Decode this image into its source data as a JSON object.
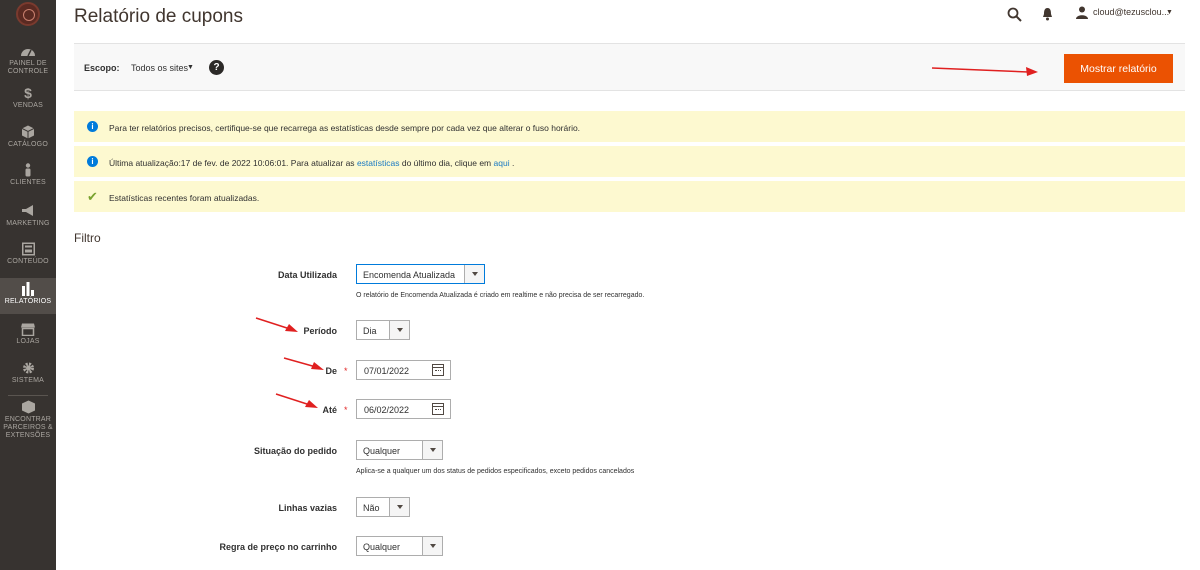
{
  "sidebar": {
    "items": [
      {
        "label": "PAINEL DE CONTROLE",
        "icon": "dashboard-icon"
      },
      {
        "label": "VENDAS",
        "icon": "dollar-icon"
      },
      {
        "label": "CATÁLOGO",
        "icon": "cube-icon"
      },
      {
        "label": "CLIENTES",
        "icon": "person-icon"
      },
      {
        "label": "MARKETING",
        "icon": "megaphone-icon"
      },
      {
        "label": "CONTEÚDO",
        "icon": "layout-icon"
      },
      {
        "label": "RELATÓRIOS",
        "icon": "bar-chart-icon"
      },
      {
        "label": "LOJAS",
        "icon": "store-icon"
      },
      {
        "label": "SISTEMA",
        "icon": "gear-icon"
      },
      {
        "label": "ENCONTRAR PARCEIROS & EXTENSÕES",
        "icon": "extensions-icon"
      }
    ],
    "active": "RELATÓRIOS"
  },
  "header": {
    "title": "Relatório de cupons",
    "user": "cloud@tezusclou..."
  },
  "scope": {
    "label": "Escopo:",
    "value": "Todos os sites",
    "help": "?",
    "show_button": "Mostrar relatório"
  },
  "messages": {
    "m1": "Para ter relatórios precisos, certifique-se que recarrega as estatísticas desde sempre por cada vez que alterar o fuso horário.",
    "m2_pre": "Última atualização:17 de fev. de 2022 10:06:01. Para atualizar as",
    "m2_link1": "estatísticas",
    "m2_mid": "do último dia, clique em",
    "m2_link2": "aqui",
    "m2_post": ".",
    "m3": "Estatísticas recentes foram atualizadas."
  },
  "filter": {
    "title": "Filtro",
    "data_utilizada": {
      "label": "Data Utilizada",
      "value": "Encomenda Atualizada",
      "note": "O relatório de Encomenda Atualizada é criado em realtime e não precisa de ser recarregado."
    },
    "periodo": {
      "label": "Período",
      "value": "Dia"
    },
    "de": {
      "label": "De",
      "required": "*",
      "value": "07/01/2022"
    },
    "ate": {
      "label": "Até",
      "required": "*",
      "value": "06/02/2022"
    },
    "situacao": {
      "label": "Situação do pedido",
      "value": "Qualquer",
      "note": "Aplica-se a qualquer um dos status de pedidos especificados, exceto pedidos cancelados"
    },
    "linhas_vazias": {
      "label": "Linhas vazias",
      "value": "Não"
    },
    "regra": {
      "label": "Regra de preço no carrinho",
      "value": "Qualquer"
    }
  },
  "colors": {
    "accent": "#eb5202",
    "sidebar": "#373330",
    "notice": "#fdf9d0",
    "arrow": "#e02020"
  }
}
